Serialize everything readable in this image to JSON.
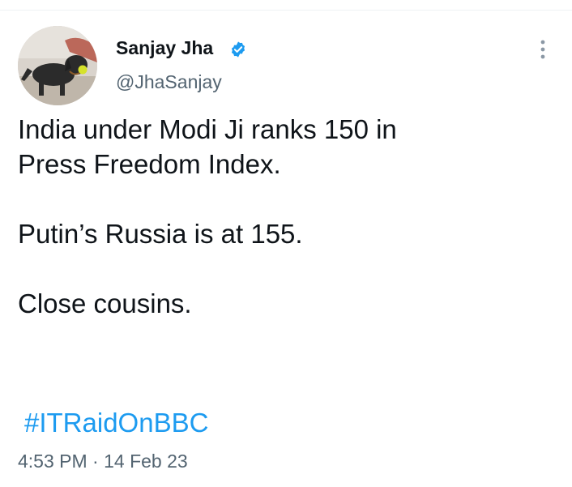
{
  "tweet": {
    "author": {
      "name": "Sanjay Jha",
      "handle": "@JhaSanjay",
      "verified": true,
      "verified_color": "#1d9bf0"
    },
    "text_paragraphs": [
      [
        "India under Modi Ji ranks 150 in",
        "Press Freedom Index."
      ],
      [
        "Putin’s Russia is at 155."
      ],
      [
        "Close cousins."
      ]
    ],
    "hashtag": "#ITRaidOnBBC",
    "timestamp": "4:53 PM · 14 Feb 23",
    "icons": {
      "verified": "verified-badge-icon",
      "more": "more-options-icon"
    },
    "colors": {
      "text": "#0f1419",
      "secondary": "#536471",
      "link": "#1d9bf0"
    }
  }
}
